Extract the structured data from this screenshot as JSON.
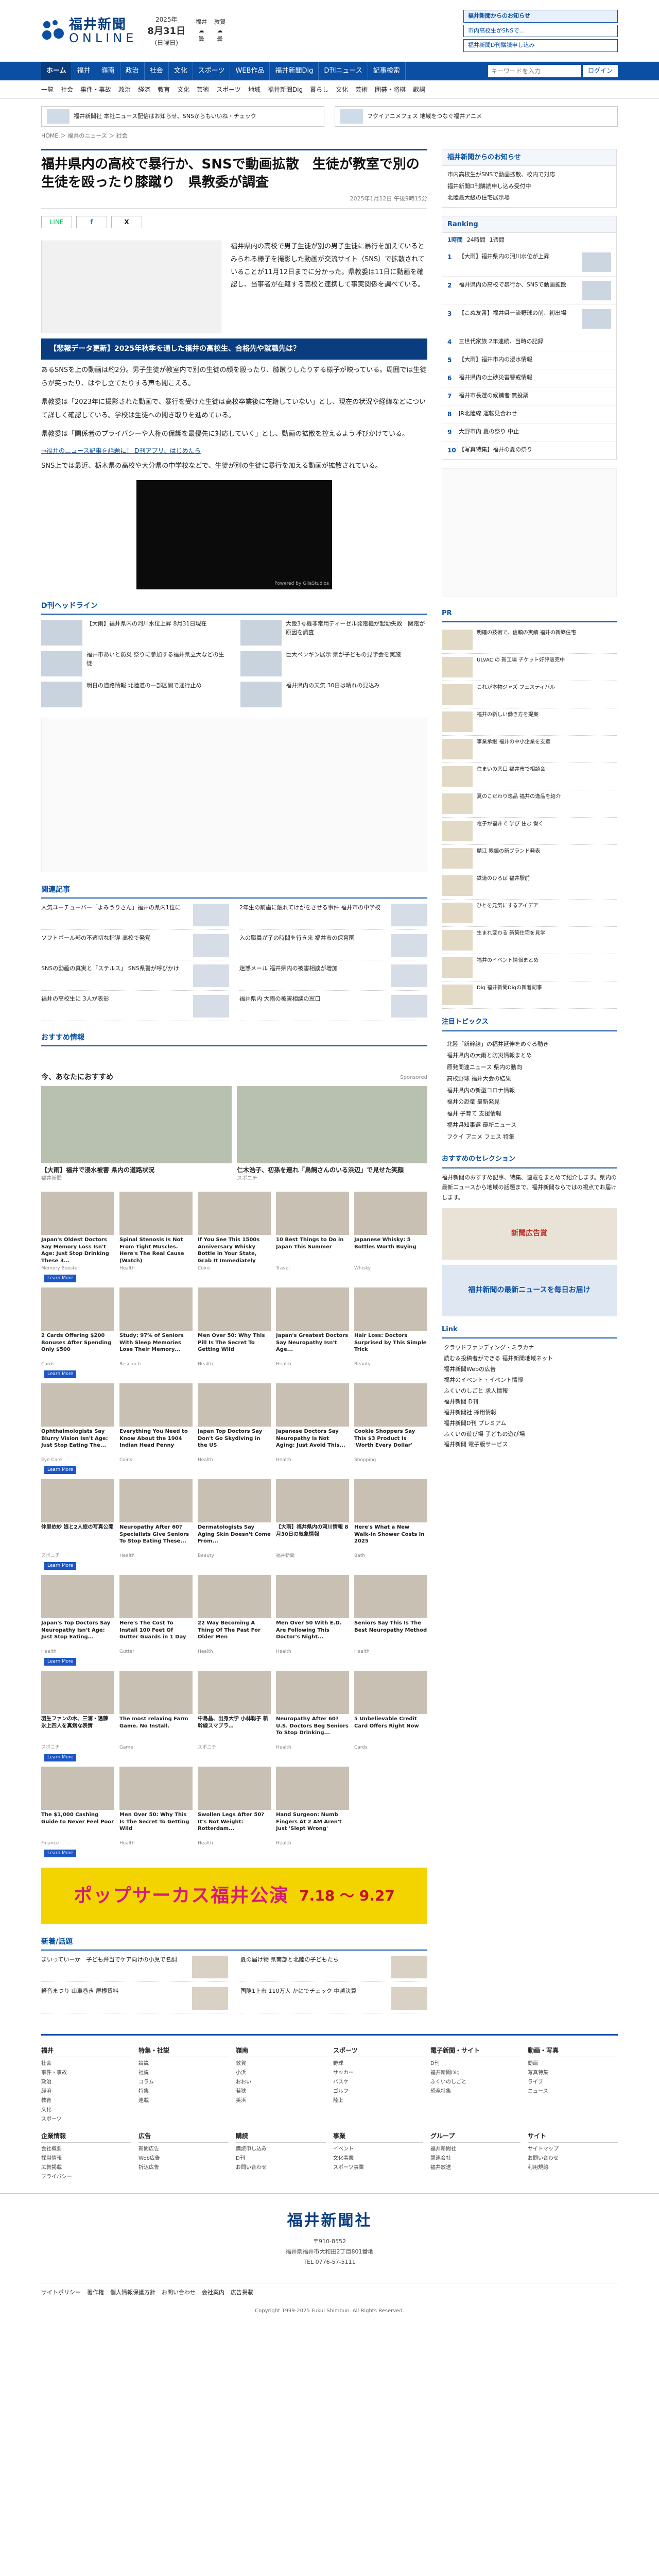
{
  "header": {
    "logo_jp": "福井新聞",
    "logo_en": "ONLINE",
    "date_year": "2025年",
    "date_main": "8月31日",
    "date_weekday": "(日曜日)",
    "weather": [
      {
        "place": "福井",
        "label": "曇"
      },
      {
        "place": "敦賀",
        "label": "曇"
      }
    ],
    "btn_primary": "福井新聞からのお知らせ",
    "btn_list": [
      "市内高校生がSNSで…",
      "福井新聞D刊購読申し込み"
    ]
  },
  "nav": {
    "items": [
      "ホーム",
      "福井",
      "嶺南",
      "政治",
      "社会",
      "文化",
      "スポーツ",
      "WEB作品",
      "福井新聞Dig",
      "D刊ニュース",
      "記事検索"
    ],
    "search_placeholder": "キーワードを入力",
    "login": "ログイン"
  },
  "subnav": [
    "一覧",
    "社会",
    "事件・事故",
    "政治",
    "経済",
    "教育",
    "文化",
    "芸術",
    "スポーツ",
    "地域",
    "福井新聞Dig",
    "暮らし",
    "文化",
    "芸術",
    "囲碁・将棋",
    "歌詞"
  ],
  "banners": [
    "福井新聞社 本社ニュース配信はお知らせ、SNSからもいいね・チェック",
    "フクイアニメフェス 地域をつなぐ福井アニメ"
  ],
  "breadcrumb": "HOME ＞ 福井のニュース ＞ 社会",
  "article": {
    "title": "福井県内の高校で暴行か、SNSで動画拡散　生徒が教室で別の生徒を殴ったり膝蹴り　県教委が調査",
    "date": "2025年1月12日 午後9時15分",
    "share": [
      "LINE",
      "f",
      "X"
    ],
    "lede": "福井県内の高校で男子生徒が別の男子生徒に暴行を加えているとみられる様子を撮影した動画が交流サイト（SNS）で拡散されていることが11月12日までに分かった。県教委は11日に動画を確認し、当事者が在籍する高校と連携して事実関係を調べている。",
    "breaking": "【悲報データ更新】2025年秋季を通した福井の高校生、合格先や就職先は？",
    "paragraphs": [
      "あるSNSを上の動画は約2分。男子生徒が教室内で別の生徒の顔を殴ったり、膝蹴りしたりする様子が映っている。周囲では生徒らが笑ったり、はやし立てたりする声も聞こえる。",
      "県教委は「2023年に撮影された動画で、暴行を受けた生徒は高校卒業後に在籍していない」とし、現在の状況や経緯などについて詳しく確認している。学校は生徒への聞き取りを進めている。",
      "県教委は「関係者のプライバシーや人権の保護を最優先に対応していく」とし、動画の拡散を控えるよう呼びかけている。",
      "SNS上では最近、栃木県の高校や大分県の中学校などで、生徒が別の生徒に暴行を加える動画が拡散されている。"
    ],
    "inline_link": "→福井のニュース記事を話題に！ D刊アプリ、はじめたら",
    "video_label": "Powered by GliaStudios"
  },
  "headlines": {
    "title": "D刊ヘッドライン",
    "items": [
      "【大雨】福井県内の河川水位上昇 8月31日現在",
      "大飯3号機非常用ディーゼル発電機が起動失敗　関電が原因を調査",
      "福井市あいと防災 祭りに参加する福井県立大などの生徒",
      "巨大ペンギン展示 県が子どもの見学会を実施",
      "明日の道路情報 北陸道の一部区間で通行止め",
      "福井県内の天気 30日は晴れの見込み"
    ]
  },
  "related": {
    "title": "関連記事",
    "items": [
      "人気ユーチューバー「よみうりさん」福井の県内1位に",
      "2年生の前歯に触れてけがをさせる事件 福井市の中学校",
      "ソフトボール部の不適切な指導 高校で発覚",
      "入の職員が子の時間を行き来 福井市の保育園",
      "SNSの動画の真実と「ステルス」 SNS県警が呼びかけ",
      "迷惑メール 福井県内の被害相談が増加",
      "福井の高校生に 3人が表彰",
      "福井県内 大雨の被害相談の窓口"
    ]
  },
  "osusume_title": "おすすめ情報",
  "recommend": {
    "title": "今、あなたにおすすめ",
    "brand": "Sponsored",
    "big": [
      {
        "t": "【大雨】福井で浸水被害 県内の道路状況",
        "s": "福井新聞"
      },
      {
        "t": "仁木浩子、初孫を連れ「鳥飼さんのいる浜辺」で見せた笑顔",
        "s": "スポニチ"
      }
    ],
    "cards": [
      {
        "t": "Japan's Oldest Doctors Say Memory Loss Isn't Age: Just Stop Drinking These 3...",
        "s": "Memory Booster"
      },
      {
        "t": "Spinal Stenosis Is Not From Tight Muscles. Here's The Real Cause (Watch)",
        "s": "Health"
      },
      {
        "t": "If You See This 1500s Anniversary Whisky Bottle in Your State, Grab It Immediately",
        "s": "Coins"
      },
      {
        "t": "10 Best Things to Do in Japan This Summer",
        "s": "Travel"
      },
      {
        "t": "Japanese Whisky: 5 Bottles Worth Buying",
        "s": "Whisky"
      },
      {
        "t": "2 Cards Offering $200 Bonuses After Spending Only $500",
        "s": "Cards"
      },
      {
        "t": "Study: 97% of Seniors With Sleep Memories Lose Their Memory...",
        "s": "Research"
      },
      {
        "t": "Men Over 50: Why This Pill Is The Secret To Getting Wild",
        "s": "Health"
      },
      {
        "t": "Japan's Greatest Doctors Say Neuropathy Isn't Age...",
        "s": "Health"
      },
      {
        "t": "Hair Loss: Doctors Surprised by This Simple Trick",
        "s": "Beauty"
      },
      {
        "t": "Ophthalmologists Say Blurry Vision Isn't Age: Just Stop Eating The...",
        "s": "Eye Care"
      },
      {
        "t": "Everything You Need to Know About the 1904 Indian Head Penny",
        "s": "Coins"
      },
      {
        "t": "Japan Top Doctors Say Don't Go Skydiving in the US",
        "s": "Health"
      },
      {
        "t": "Japanese Doctors Say Neuropathy Is Not Aging: Just Avoid This...",
        "s": "Health"
      },
      {
        "t": "Cookie Shoppers Say This $3 Product Is 'Worth Every Dollar'",
        "s": "Shopping"
      },
      {
        "t": "仲里依紗 娘と2人旅の写真公開",
        "s": "スポニチ"
      },
      {
        "t": "Neuropathy After 60? Specialists Give Seniors To Stop Eating These...",
        "s": "Health"
      },
      {
        "t": "Dermatologists Say Aging Skin Doesn't Come From...",
        "s": "Beauty"
      },
      {
        "t": "【大雨】福井県内の河川情報 8月30日の気象情報",
        "s": "福井新聞"
      },
      {
        "t": "Here's What a New Walk-in Shower Costs In 2025",
        "s": "Bath"
      },
      {
        "t": "Japan's Top Doctors Say Neuropathy Isn't Age: Just Stop Eating...",
        "s": "Health"
      },
      {
        "t": "Here's The Cost To Install 100 Feet Of Gutter Guards in 1 Day",
        "s": "Gutter"
      },
      {
        "t": "22 Way Becoming A Thing Of The Past For Older Men",
        "s": "Health"
      },
      {
        "t": "Men Over 50 With E.D. Are Following This Doctor's Night...",
        "s": "Health"
      },
      {
        "t": "Seniors Say This Is The Best Neuropathy Method",
        "s": "Health"
      },
      {
        "t": "羽生ファンの木、三浦・遠藤 氷上四人を真剣な表情",
        "s": "スポニチ"
      },
      {
        "t": "The most relaxing Farm Game. No Install.",
        "s": "Game"
      },
      {
        "t": "中島晶、出身大学 小林聡子 新幹線スマブラ…",
        "s": "スポニチ"
      },
      {
        "t": "Neuropathy After 60? U.S. Doctors Beg Seniors To Stop Drinking...",
        "s": "Health"
      },
      {
        "t": "5 Unbelievable Credit Card Offers Right Now",
        "s": "Cards"
      },
      {
        "t": "The $1,000 Cashing Guide to Never Feel Poor",
        "s": "Finance"
      },
      {
        "t": "Men Over 50: Why This Is The Secret To Getting Wild",
        "s": "Health"
      },
      {
        "t": "Swollen Legs After 50? It's Not Weight: Rotterdam...",
        "s": "Health"
      },
      {
        "t": "Hand Surgeon: Numb Fingers At 2 AM Aren't Just 'Slept Wrong'",
        "s": "Health"
      }
    ],
    "learn_more": "Learn More"
  },
  "wide_banner": {
    "b1": "ポップサーカス福井公演",
    "b2": "7.18 ～ 9.27"
  },
  "popular": {
    "title": "新着/話題",
    "items": [
      "まいっていーか　子ども弁当でケア向けの小児で名調",
      "夏の届け物 県南部と北陸の子どもたち",
      "軽音まつり 山車巻き 屋根賃料",
      "国際1上市 110万人 かにでチェック 中越決算"
    ]
  },
  "sidebar": {
    "notice_title": "福井新聞からのお知らせ",
    "notices": [
      "市内高校生がSNSで動画拡散、校内で対応",
      "福井新聞D刊購読申し込み受付中",
      "北陸最大級の住宅展示場"
    ],
    "ranking_title": "Ranking",
    "ranking_tabs": [
      "1時間",
      "24時間",
      "1週間"
    ],
    "ranking": [
      "【大雨】福井県内の河川水位が上昇",
      "福井県内の高校で暴行か、SNSで動画拡散",
      "【こぬ友番】福井県一流野球の前、初出場",
      "三世代家族 2年連続、当時の記録",
      "【大雨】福井市内の浸水情報",
      "福井県内の土砂災害警戒情報",
      "福井市長選の候補者 無投票",
      "JR北陸線 運転見合わせ",
      "大野市内 夏の祭り 中止",
      "【写真特集】福井の夏の祭り"
    ],
    "pr_title": "PR",
    "pr": [
      "明確の技術で、信頼の実績 福井の新築住宅",
      "ULVAC の 新工場 チケット好評販売中",
      "これが本物ジャズ フェスティバル",
      "福井の新しい働き方を提案",
      "事業承継 福井の中小企業を支援",
      "住まいの窓口 福井市で相談会",
      "夏のこだわり逸品 福井の逸品を紹介",
      "電子が福井で 学び 住む 働く",
      "鯖江 眼鏡の新ブランド発表",
      "鉄道のひろば 福井駅前",
      "ひとを元気にするアイデア",
      "生まれ変わる 新築住宅を見学",
      "福井のイベント情報まとめ",
      "Dig 福井新聞Digの新着記事"
    ],
    "attention_title": "注目トピックス",
    "attention": [
      "北陸「新幹線」の福井延伸をめぐる動き",
      "福井県内の大雨と防災情報まとめ",
      "原発関連ニュース 県内の動向",
      "高校野球 福井大会の結果",
      "福井県内の新型コロナ情報",
      "福井の恐竜 最新発見",
      "福井 子育て 支援情報",
      "福井県知事選 最新ニュース",
      "フクイ アニメ フェス 特集"
    ],
    "collection_title": "おすすめのセレクション",
    "collection_text": "福井新聞のおすすめ記事、特集、連載をまとめて紹介します。県内の最新ニュースから地域の話題まで、福井新聞ならではの視点でお届けします。",
    "promo": "新聞広告賞",
    "promo2": "福井新聞の最新ニュースを毎日お届け",
    "link_title": "Link",
    "links": [
      "クラウドファンディング・ミラカナ",
      "読む＆投稿者ができる 福井新聞地域ネット",
      "福井新聞Webの広告",
      "福井のイベント・イベント情報",
      "ふくいのしごと 求人情報",
      "福井新聞 D刊",
      "福井新聞社 採用情報",
      "福井新聞D刊 プレミアム",
      "ふくいの遊び場 子どもの遊び場",
      "福井新聞 電子版サービス"
    ]
  },
  "footer": {
    "cols": [
      {
        "h": "福井",
        "l": [
          "社会",
          "事件・事故",
          "政治",
          "経済",
          "教育",
          "文化",
          "スポーツ"
        ]
      },
      {
        "h": "特集・社説",
        "l": [
          "論説",
          "社説",
          "コラム",
          "特集",
          "連載"
        ]
      },
      {
        "h": "嶺南",
        "l": [
          "敦賀",
          "小浜",
          "おおい",
          "若狭",
          "美浜"
        ]
      },
      {
        "h": "スポーツ",
        "l": [
          "野球",
          "サッカー",
          "バスケ",
          "ゴルフ",
          "陸上"
        ]
      },
      {
        "h": "電子新聞・サイト",
        "l": [
          "D刊",
          "福井新聞Dig",
          "ふくいのしごと",
          "恐竜特集"
        ]
      },
      {
        "h": "動画・写真",
        "l": [
          "動画",
          "写真特集",
          "ライブ",
          "ニュース"
        ]
      },
      {
        "h": "企業情報",
        "l": [
          "会社概要",
          "採用情報",
          "広告掲載",
          "プライバシー"
        ]
      },
      {
        "h": "広告",
        "l": [
          "新聞広告",
          "Web広告",
          "折込広告"
        ]
      },
      {
        "h": "購読",
        "l": [
          "購読申し込み",
          "D刊",
          "お問い合わせ"
        ]
      },
      {
        "h": "事業",
        "l": [
          "イベント",
          "文化事業",
          "スポーツ事業"
        ]
      },
      {
        "h": "グループ",
        "l": [
          "福井新聞社",
          "関連会社",
          "福井放送"
        ]
      },
      {
        "h": "サイト",
        "l": [
          "サイトマップ",
          "お問い合わせ",
          "利用規約"
        ]
      }
    ],
    "brand": "福井新聞社",
    "postal": "〒910-8552",
    "address": "福井県福井市大和田2丁目801番地",
    "tel": "TEL 0776-57-5111",
    "bottom_links": [
      "サイトポリシー",
      "著作権",
      "個人情報保護方針",
      "お問い合わせ",
      "会社案内",
      "広告掲載"
    ],
    "copyright": "Copyright 1999-2025 Fukui Shimbun. All Rights Reserved."
  }
}
